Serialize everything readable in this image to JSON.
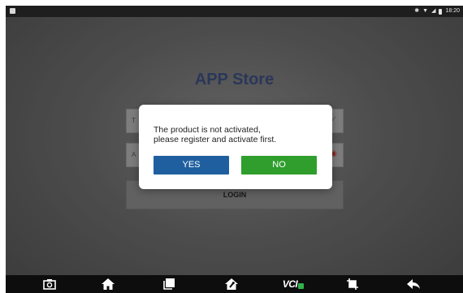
{
  "status_bar": {
    "time": "18:20",
    "icons": [
      "notification-icon",
      "bluetooth-icon",
      "wifi-icon",
      "signal-icon",
      "battery-icon"
    ]
  },
  "app": {
    "title": "APP Store",
    "field1_lead": "T",
    "field2_lead": "A",
    "field1_trail_icon": "chevron-down-icon",
    "field2_trail_icon": "eye-icon",
    "login_label": "LOGIN"
  },
  "dialog": {
    "message_line1": "The product is not activated,",
    "message_line2": "please register and activate first.",
    "yes_label": "YES",
    "no_label": "NO"
  },
  "nav": {
    "items": [
      {
        "name": "screenshot-icon"
      },
      {
        "name": "home-icon"
      },
      {
        "name": "recent-apps-icon"
      },
      {
        "name": "diagnose-icon"
      },
      {
        "name": "vci-icon",
        "label": "VCI"
      },
      {
        "name": "crop-icon"
      },
      {
        "name": "back-icon"
      }
    ]
  },
  "colors": {
    "title": "#3e4f80",
    "yes_button": "#1f5fa0",
    "no_button": "#2f9e2d",
    "vci_badge": "#2fb34a"
  }
}
